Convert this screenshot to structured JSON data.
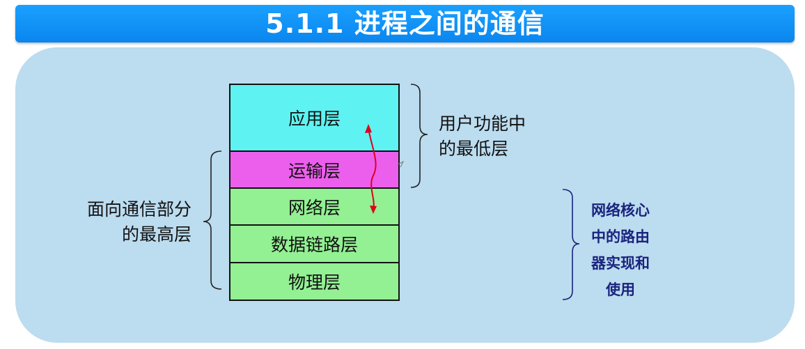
{
  "title": "5.1.1   进程之间的通信",
  "layers": {
    "application": "应用层",
    "transport": "运输层",
    "network": "网络层",
    "datalink": "数据链路层",
    "physical": "物理层"
  },
  "labels": {
    "user_lines": [
      "用户功能中",
      "的最低层"
    ],
    "comm_lines": [
      "面向通信部分",
      "的最高层"
    ],
    "router_lines": [
      "网络核心",
      "中的路由",
      "器实现和",
      "使用"
    ]
  },
  "colors": {
    "title_bar": "#0a86ee",
    "panel": "#bcdcef",
    "application": "#5ef2f2",
    "transport": "#ec5fec",
    "lower_layers": "#93f093",
    "arrow": "#e0001a",
    "router_text": "#1a237e"
  }
}
